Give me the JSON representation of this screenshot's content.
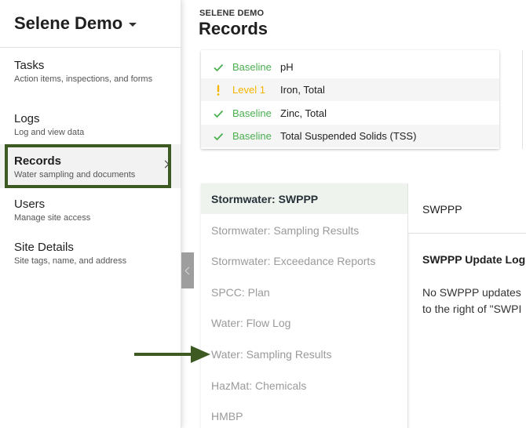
{
  "brand": {
    "title": "Selene Demo",
    "icon": "caret-down-icon"
  },
  "sidebar": {
    "items": [
      {
        "title": "Tasks",
        "subtitle": "Action items, inspections, and forms"
      },
      {
        "title": "Logs",
        "subtitle": "Log and view data"
      },
      {
        "title": "Records",
        "subtitle": "Water sampling and documents"
      },
      {
        "title": "Users",
        "subtitle": "Manage site access"
      },
      {
        "title": "Site Details",
        "subtitle": "Site tags, name, and address"
      }
    ],
    "active_index": 2
  },
  "header": {
    "kicker": "SELENE DEMO",
    "title": "Records"
  },
  "status_rows": [
    {
      "status": "Baseline",
      "name": "pH",
      "icon": "check-icon",
      "color": "#4caf50"
    },
    {
      "status": "Level 1",
      "name": "Iron, Total",
      "icon": "exclamation-icon",
      "color": "#f5b400"
    },
    {
      "status": "Baseline",
      "name": "Zinc, Total",
      "icon": "check-icon",
      "color": "#4caf50"
    },
    {
      "status": "Baseline",
      "name": "Total Suspended Solids (TSS)",
      "icon": "check-icon",
      "color": "#4caf50"
    }
  ],
  "records_list": [
    "Stormwater: SWPPP",
    "Stormwater: Sampling Results",
    "Stormwater: Exceedance Reports",
    "SPCC: Plan",
    "Water: Flow Log",
    "Water: Sampling Results",
    "HazMat: Chemicals",
    "HMBP"
  ],
  "detail": {
    "title": "SWPPP",
    "log_title": "SWPPP Update Log",
    "log_lines": [
      "No SWPPP updates",
      "to the right of \"SWPI"
    ]
  },
  "colors": {
    "highlight": "#3c5a22",
    "accent_green": "#4caf50",
    "warning": "#f5b400"
  }
}
